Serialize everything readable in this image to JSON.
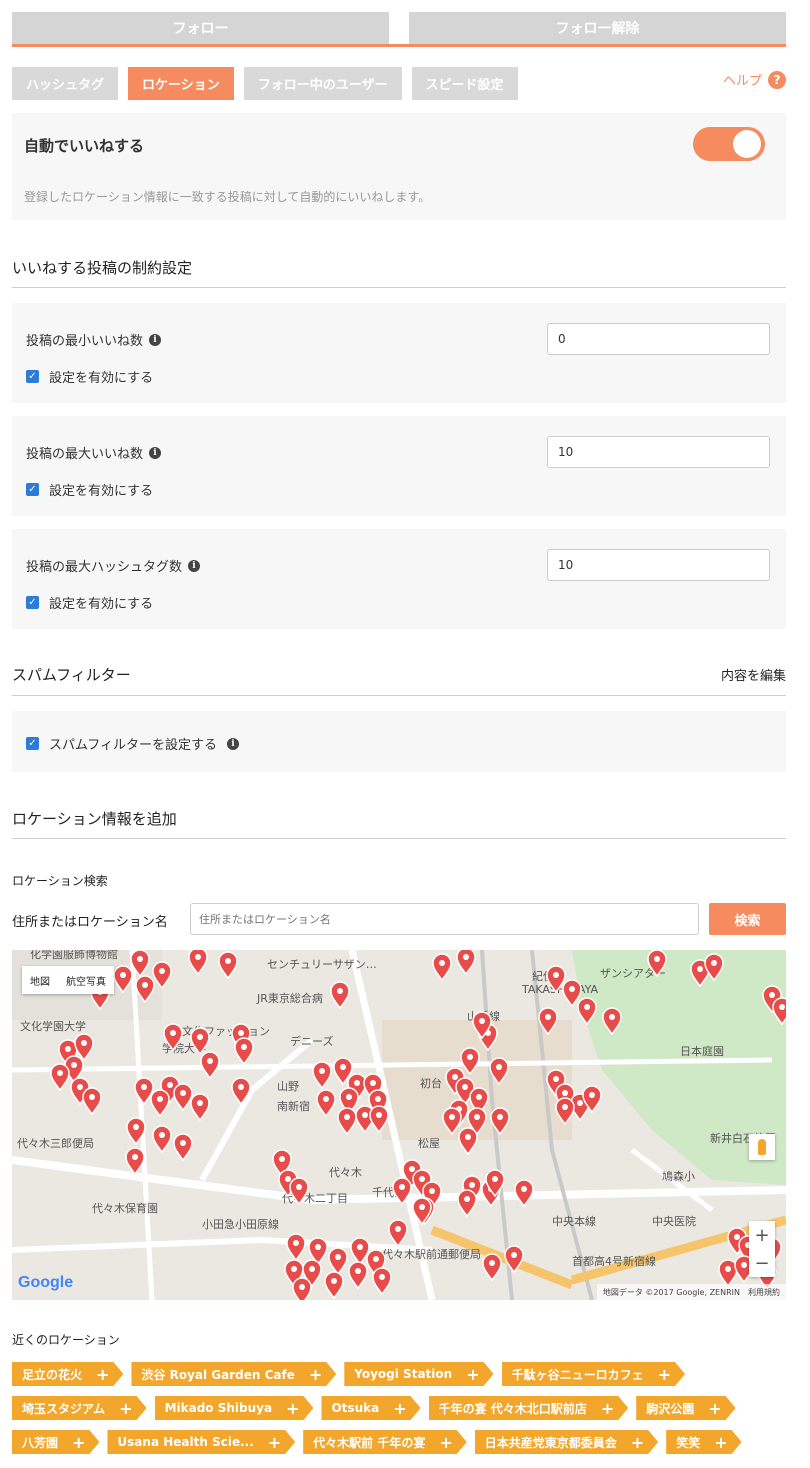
{
  "top_tabs": {
    "follow": "フォロー",
    "unfollow": "フォロー解除"
  },
  "sub_tabs": [
    "ハッシュタグ",
    "ロケーション",
    "フォロー中のユーザー",
    "スピード設定"
  ],
  "active_sub_tab": "ロケーション",
  "help": {
    "label": "ヘルプ",
    "icon": "?"
  },
  "autolike": {
    "title": "自動でいいねする",
    "enabled": true,
    "description": "登録したロケーション情報に一致する投稿に対して自動的にいいねします。"
  },
  "constraints": {
    "title": "いいねする投稿の制約設定",
    "items": [
      {
        "label": "投稿の最小いいね数",
        "value": "0",
        "check_label": "設定を有効にする",
        "checked": true
      },
      {
        "label": "投稿の最大いいね数",
        "value": "10",
        "check_label": "設定を有効にする",
        "checked": true
      },
      {
        "label": "投稿の最大ハッシュタグ数",
        "value": "10",
        "check_label": "設定を有効にする",
        "checked": true
      }
    ]
  },
  "spam": {
    "title": "スパムフィルター",
    "edit": "内容を編集",
    "check_label": "スパムフィルターを設定する",
    "checked": true
  },
  "add_location": {
    "title": "ロケーション情報を追加",
    "search_label": "ロケーション検索",
    "address_label": "住所またはロケーション名",
    "placeholder": "住所またはロケーション名",
    "search_button": "検索"
  },
  "map": {
    "type_map": "地図",
    "type_satellite": "航空写真",
    "zoom_in": "+",
    "zoom_out": "−",
    "logo": "Google",
    "credit": "地図データ ©2017 Google, ZENRIN",
    "terms": "利用規約",
    "labels": [
      "化学園服飾博物館",
      "センチュリーサザン…",
      "紀伊國",
      "ザンシアター",
      "TAKASHIMAYA",
      "JR東京総合病",
      "文化学園大学",
      "文化ファッション",
      "学院大学",
      "デニーズ",
      "日本庭園",
      "初台",
      "山野",
      "南新宿",
      "代々木三郎便局",
      "松屋",
      "新井白石終焉",
      "代々木保育園",
      "代々木",
      "鳩森小",
      "代々木二丁目",
      "千代田",
      "中央医院",
      "小田急小田原線",
      "中央本線",
      "代々木駅前通郵便局",
      "首都高4号新宿線",
      "山手線"
    ]
  },
  "nearby": {
    "title": "近くのロケーション",
    "locations": [
      [
        "足立の花火",
        "渋谷 Royal Garden Cafe",
        "Yoyogi Station",
        "千駄ヶ谷ニューロカフェ"
      ],
      [
        "埼玉スタジアム",
        "Mikado Shibuya",
        "Otsuka",
        "千年の宴 代々木北口駅前店",
        "駒沢公園"
      ],
      [
        "八芳園",
        "Usana Health Scie...",
        "代々木駅前 千年の宴",
        "日本共産党東京都委員会",
        "笑笑"
      ]
    ]
  },
  "colors": {
    "accent": "#f58b5e",
    "chip": "#f2a72c",
    "checkbox": "#2b7bd8",
    "pin": "#e84c4a"
  }
}
